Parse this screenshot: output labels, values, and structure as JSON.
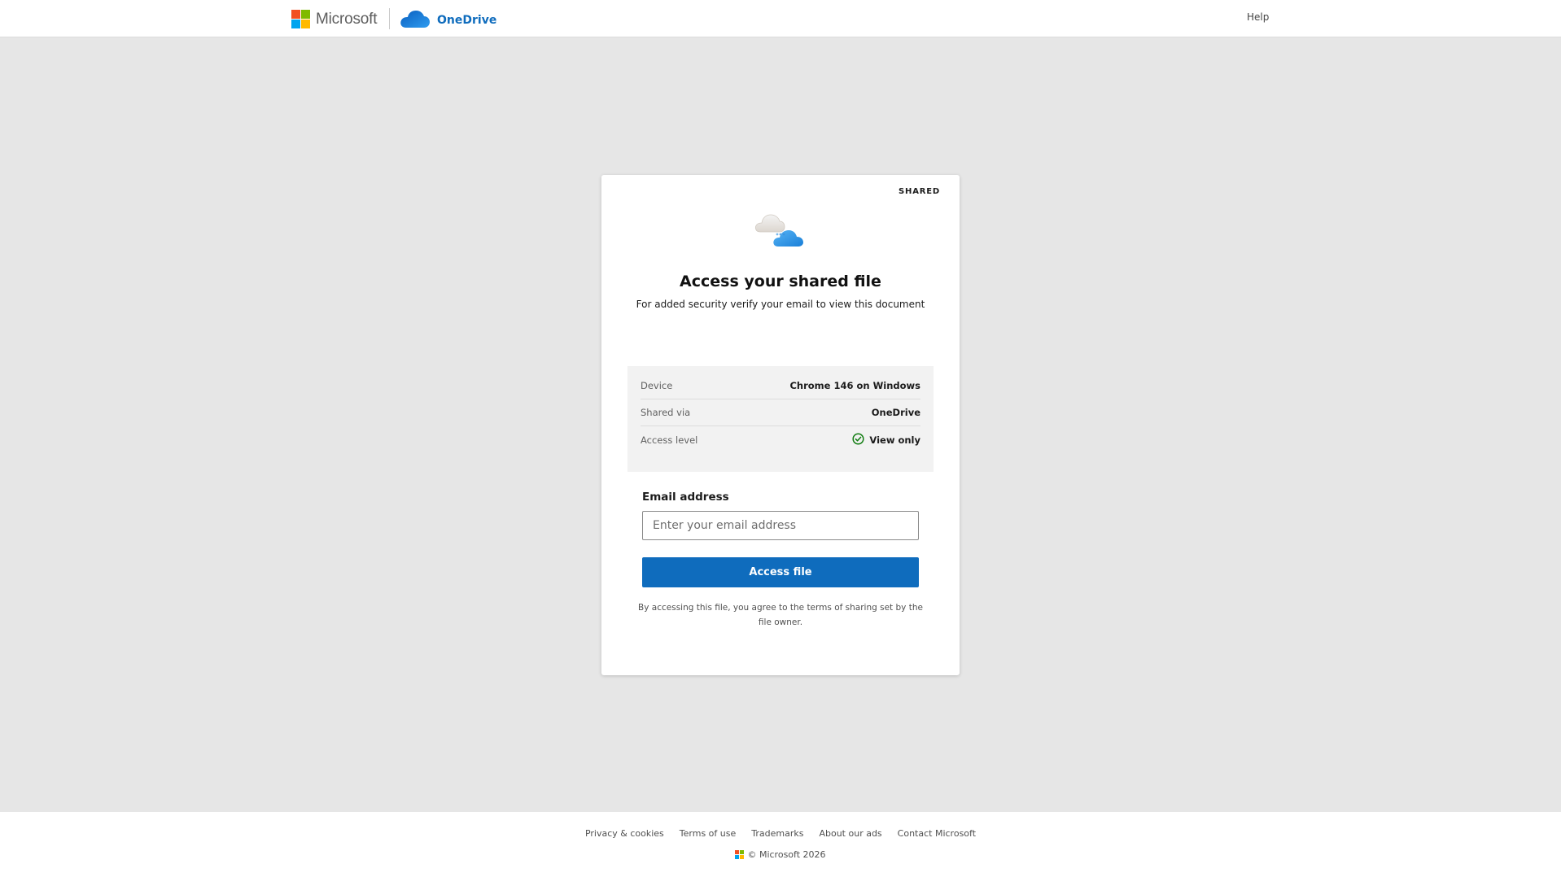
{
  "header": {
    "brand_name": "Microsoft",
    "product_name": "OneDrive",
    "help_label": "Help"
  },
  "card": {
    "badge": "SHARED",
    "title": "Access your shared file",
    "subtitle": "For added security verify your email to view this document",
    "details": [
      {
        "key": "Device",
        "value": "Chrome 146 on Windows"
      },
      {
        "key": "Shared via",
        "value": "OneDrive"
      },
      {
        "key": "Access level",
        "value": "View only",
        "icon": "check-circle-icon"
      }
    ],
    "email_label": "Email address",
    "email_value": "",
    "email_placeholder": "Enter your email address",
    "submit_label": "Access file",
    "legal_text": "By accessing this file, you agree to the terms of sharing set by the file owner."
  },
  "footer": {
    "links": [
      "Privacy & cookies",
      "Terms of use",
      "Trademarks",
      "About our ads",
      "Contact Microsoft"
    ],
    "copyright": "© Microsoft 2026"
  },
  "colors": {
    "accent": "#0f6cbd",
    "page_background": "#e6e6e6",
    "ms_red": "#f25022",
    "ms_green": "#7fba00",
    "ms_blue": "#00a4ef",
    "ms_yellow": "#ffb900",
    "success_green": "#107c10"
  }
}
